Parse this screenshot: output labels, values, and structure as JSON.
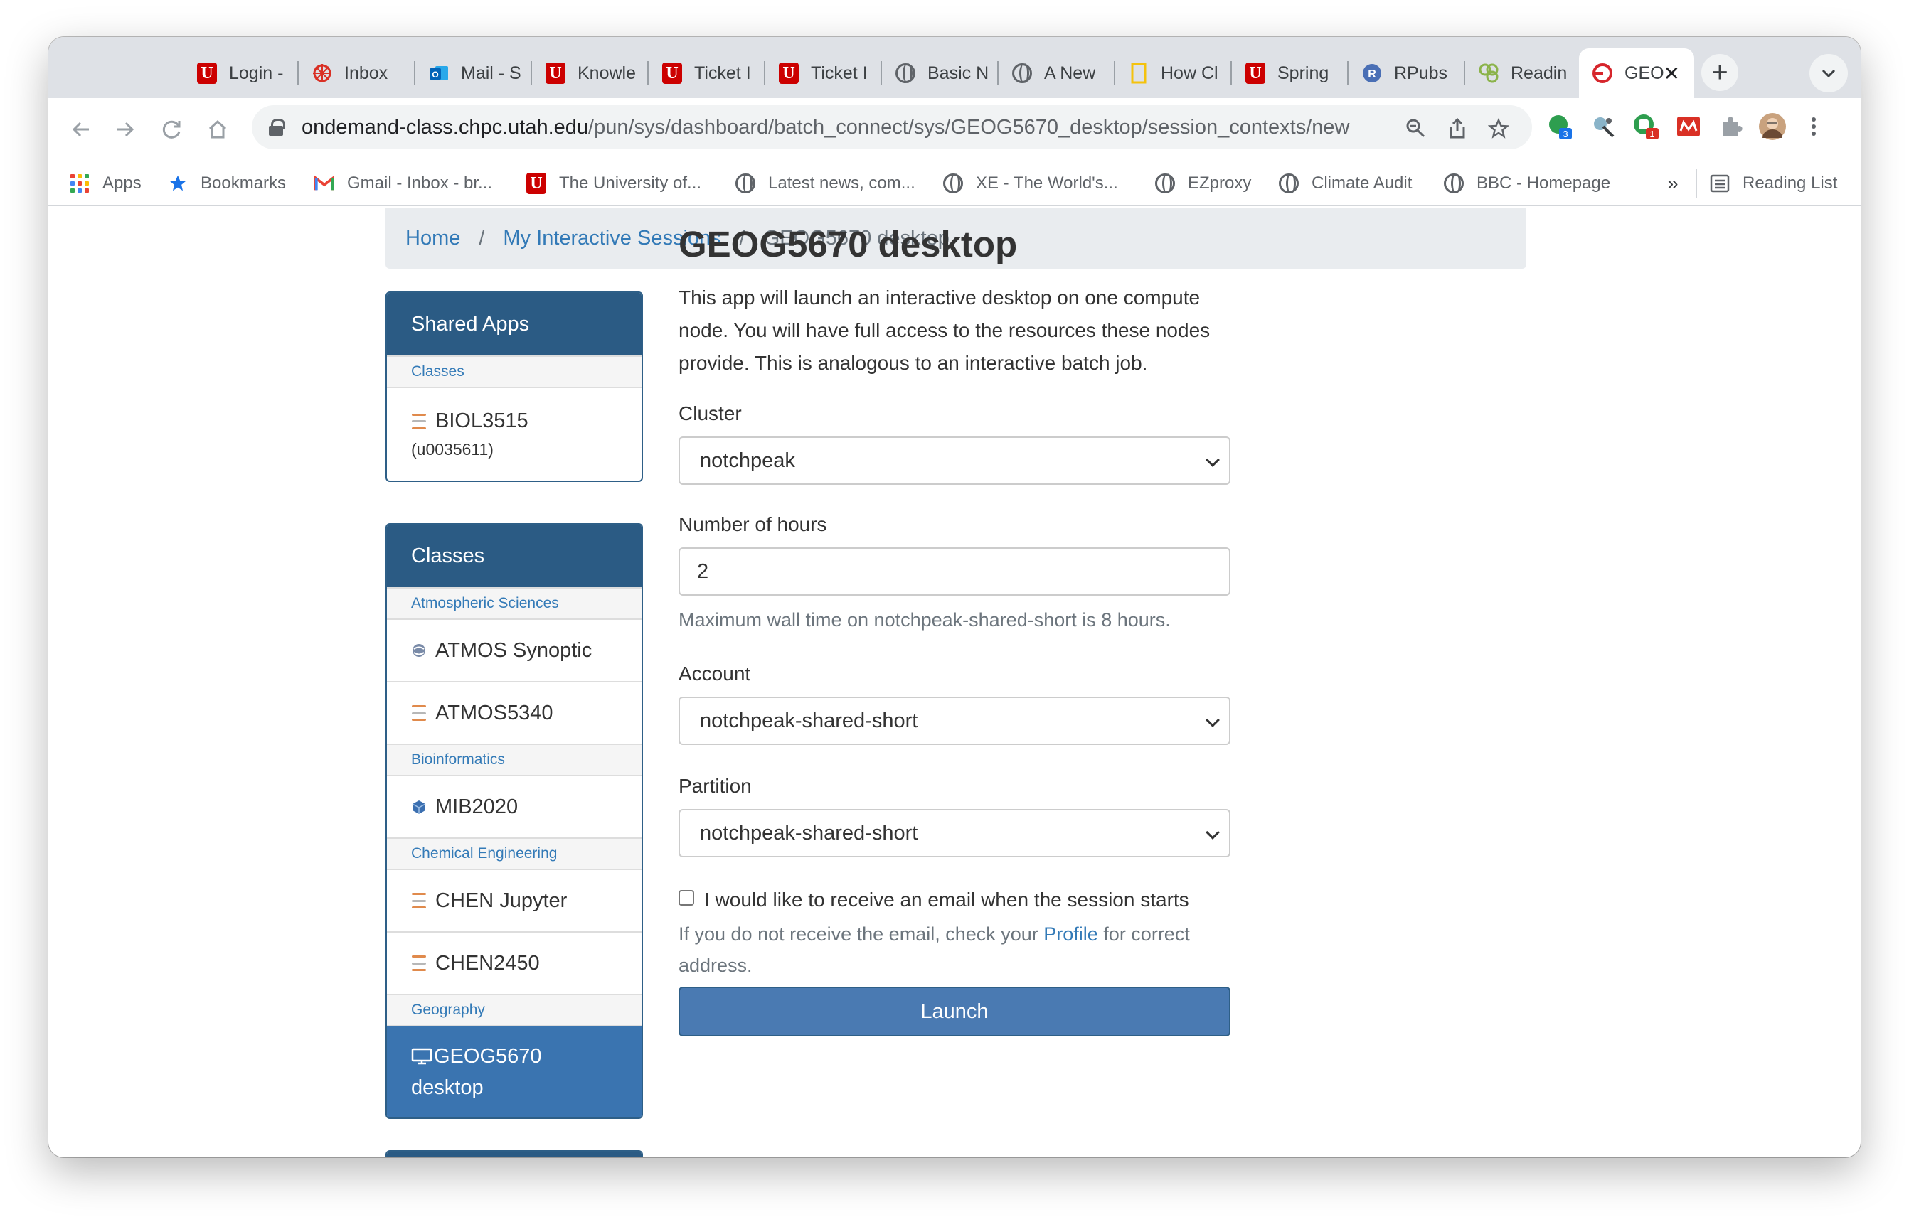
{
  "browser": {
    "tabs": [
      {
        "title": "Login -",
        "icon": "u-logo"
      },
      {
        "title": "Inbox",
        "icon": "dharma-wheel-icon"
      },
      {
        "title": "Mail - S",
        "icon": "outlook-icon"
      },
      {
        "title": "Knowle",
        "icon": "u-logo"
      },
      {
        "title": "Ticket I",
        "icon": "u-logo"
      },
      {
        "title": "Ticket I",
        "icon": "u-logo"
      },
      {
        "title": "Basic N",
        "icon": "globe-icon"
      },
      {
        "title": "A New",
        "icon": "globe-icon"
      },
      {
        "title": "How Cl",
        "icon": "natgeo-icon"
      },
      {
        "title": "Spring",
        "icon": "u-logo"
      },
      {
        "title": "RPubs",
        "icon": "rpubs-icon"
      },
      {
        "title": "Readin",
        "icon": "reading-icon"
      },
      {
        "title": "GEO",
        "icon": "ondemand-icon",
        "active": true
      }
    ],
    "url_host": "ondemand-class.chpc.utah.edu",
    "url_path": "/pun/sys/dashboard/batch_connect/sys/GEOG5670_desktop/session_contexts/new",
    "extension_badges": {
      "ext1": "3",
      "ext2": "1"
    },
    "bookmarks": [
      {
        "label": "Apps",
        "icon": "apps-grid-icon"
      },
      {
        "label": "Bookmarks",
        "icon": "star-icon"
      },
      {
        "label": "Gmail - Inbox - br...",
        "icon": "gmail-icon"
      },
      {
        "label": "The University of...",
        "icon": "u-logo"
      },
      {
        "label": "Latest news, com...",
        "icon": "globe-icon"
      },
      {
        "label": "XE - The World's...",
        "icon": "globe-icon"
      },
      {
        "label": "EZproxy",
        "icon": "globe-icon"
      },
      {
        "label": "Climate Audit",
        "icon": "globe-icon"
      },
      {
        "label": "BBC - Homepage",
        "icon": "globe-icon"
      }
    ],
    "overflow": "»",
    "reading_list": "Reading List"
  },
  "breadcrumb": {
    "home": "Home",
    "sessions": "My Interactive Sessions",
    "current": "GEOG5670 desktop",
    "sep": "/"
  },
  "sidebar": {
    "shared": {
      "header": "Shared Apps",
      "category": "Classes",
      "item": "BIOL3515",
      "item_sub": "(u0035611)"
    },
    "classes": {
      "header": "Classes",
      "cat_atmos": "Atmospheric Sciences",
      "atmos_1": "ATMOS Synoptic",
      "atmos_2": "ATMOS5340",
      "cat_bio": "Bioinformatics",
      "bio_1": "MIB2020",
      "cat_chem": "Chemical Engineering",
      "chem_1": "CHEN Jupyter",
      "chem_2": "CHEN2450",
      "cat_geo": "Geography",
      "geo_1": "GEOG5670",
      "geo_1b": "desktop"
    }
  },
  "form": {
    "title": "GEOG5670 desktop",
    "description": "This app will launch an interactive desktop on one compute node. You will have full access to the resources these nodes provide. This is analogous to an interactive batch job.",
    "cluster_label": "Cluster",
    "cluster_value": "notchpeak",
    "hours_label": "Number of hours",
    "hours_value": "2",
    "hours_help": "Maximum wall time on notchpeak-shared-short is 8 hours.",
    "account_label": "Account",
    "account_value": "notchpeak-shared-short",
    "partition_label": "Partition",
    "partition_value": "notchpeak-shared-short",
    "email_label": "I would like to receive an email when the session starts",
    "email_checked": false,
    "email_help_pre": "If you do not receive the email, check your ",
    "email_help_link": "Profile",
    "email_help_post": " for correct address.",
    "launch_label": "Launch"
  },
  "colors": {
    "panel_header": "#2b5b84",
    "link": "#337ab7",
    "launch_button": "#4a7ab2",
    "active_item": "#3a74b0"
  }
}
